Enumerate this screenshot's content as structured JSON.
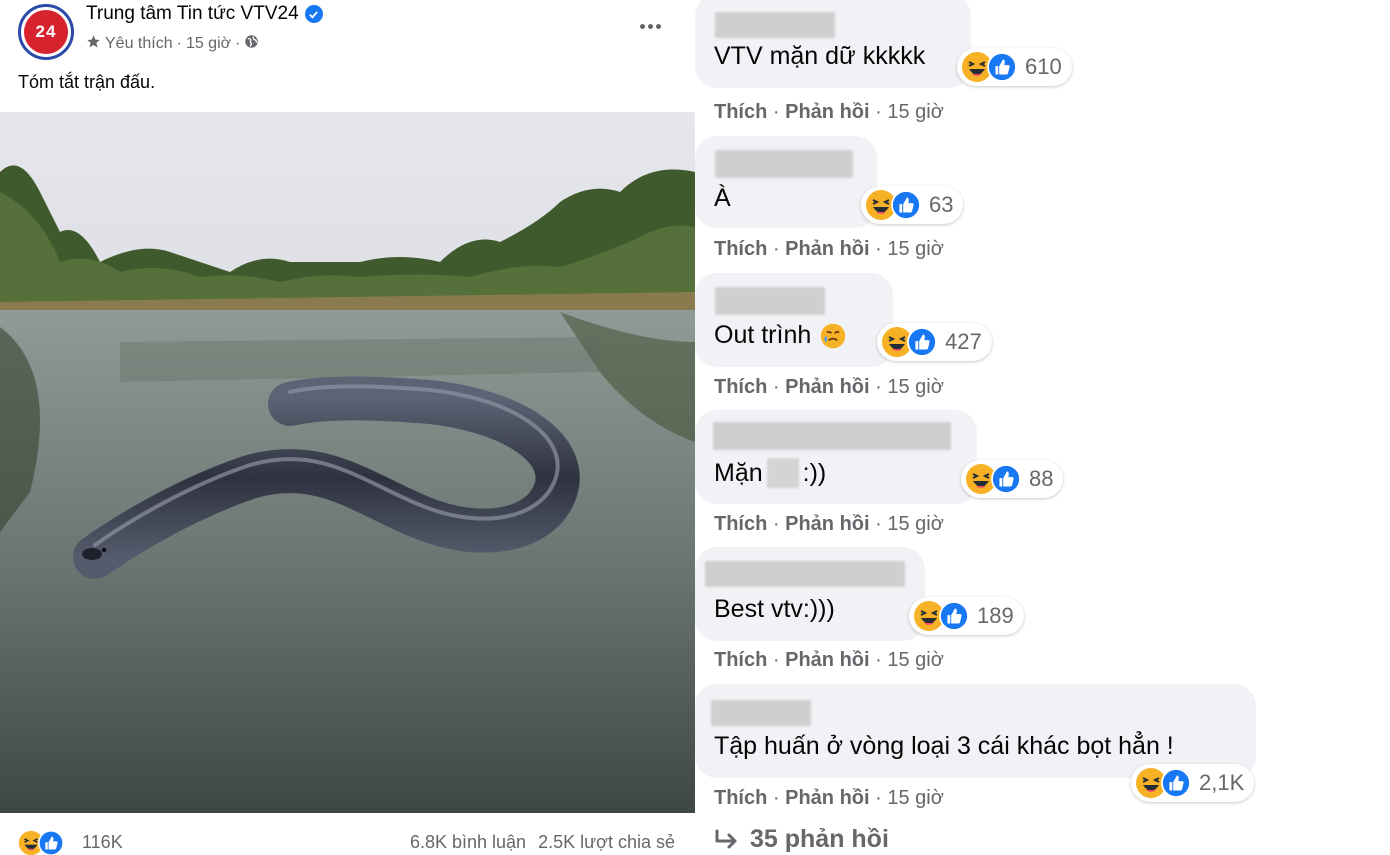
{
  "post": {
    "page_name": "Trung tâm Tin tức VTV24",
    "avatar_text": "24",
    "favorite_label": "Yêu thích",
    "time": "15 giờ",
    "separator": "·",
    "caption": "Tóm tắt trận đấu.",
    "reaction_count": "116K",
    "comments_count": "6.8K bình luận",
    "shares_count": "2.5K lượt chia sẻ",
    "icons": [
      "star-icon",
      "globe-icon",
      "verified-icon",
      "more-icon",
      "haha-icon",
      "like-icon"
    ]
  },
  "comments": [
    {
      "text": "VTV mặn dữ kkkkk",
      "reactions": "610",
      "like": "Thích",
      "reply": "Phản hồi",
      "time": "15 giờ"
    },
    {
      "text": "À",
      "reactions": "63",
      "like": "Thích",
      "reply": "Phản hồi",
      "time": "15 giờ"
    },
    {
      "text": "Out trình",
      "reactions": "427",
      "like": "Thích",
      "reply": "Phản hồi",
      "time": "15 giờ"
    },
    {
      "text_before": "Mặn",
      "text_after": ":))",
      "reactions": "88",
      "like": "Thích",
      "reply": "Phản hồi",
      "time": "15 giờ"
    },
    {
      "text": "Best vtv:)))",
      "reactions": "189",
      "like": "Thích",
      "reply": "Phản hồi",
      "time": "15 giờ"
    },
    {
      "text": "Tập huấn ở vòng loại 3 cái khác bọt hẳn !",
      "reactions": "2,1K",
      "like": "Thích",
      "reply": "Phản hồi",
      "time": "15 giờ"
    }
  ],
  "replies_link": "35 phản hồi",
  "colors": {
    "bubble": "#f0f2f5",
    "secondary_text": "#65676b",
    "like_blue": "#1877f2",
    "haha_yellow": "#f7b125"
  }
}
